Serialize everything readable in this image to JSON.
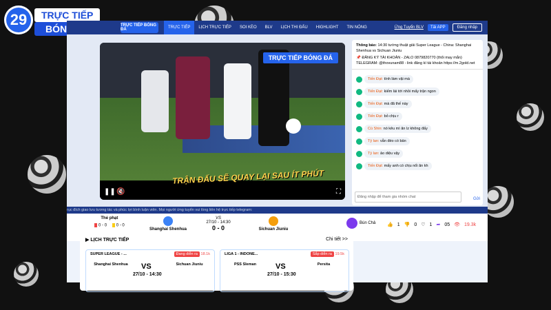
{
  "brand": {
    "number": "29",
    "line1": "TRỰC TIẾP",
    "line2": "BÓNG ĐÁ"
  },
  "nav": {
    "items": [
      "TRỰC TIẾP",
      "LỊCH TRỰC TIẾP",
      "SOI KÈO",
      "BLV",
      "LỊCH THI ĐẤU",
      "HIGHLIGHT",
      "TIN NÓNG"
    ],
    "apply_blv": "Ứng Tuyển BLV",
    "app": "Tải APP",
    "login": "Đăng nhập",
    "logo_text": "TRỰC TIẾP BÓNG ĐÁ"
  },
  "player": {
    "overlay_logo": "TRỰC TIẾP BÓNG ĐÁ",
    "marquee": "TRẬN ĐẤU SẼ QUAY LẠI SAU ÍT PHÚT"
  },
  "chat": {
    "notice_label": "Thông báo:",
    "notice_text": " 14:30 tường thuật giải Super League - China: Shanghai Shenhua vs Sichuan Jiuniu",
    "register": "📌 ĐĂNG KÝ TÀI KHOẢN - ZALO 0879820770 (thổi may mắn) TELEGRAM: @thovunam88 - link đăng kí tài khoản https://m.2gold.net",
    "messages": [
      {
        "user": "Tiến Đạt:",
        "text": "tính làm vậi mà"
      },
      {
        "user": "Tiến Đạt:",
        "text": "kiếm lái tới nhồi mấy trận ngon"
      },
      {
        "user": "Tiến Đạt:",
        "text": "mà đã thế này"
      },
      {
        "user": "Tiến Đạt:",
        "text": "bỏ chịu r"
      },
      {
        "user": "Cù Shin:",
        "text": "nó kêu mì ăn lz không đấy"
      },
      {
        "user": "Tý lan:",
        "text": "vẫn đéo có bản"
      },
      {
        "user": "Tý lan:",
        "text": "ảo diệu vậy"
      },
      {
        "user": "Tiến Đạt:",
        "text": "mấy anh có chịu nổi ăn kh"
      }
    ],
    "input_placeholder": "Đăng nhập để tham gia nhóm chat",
    "send": "Gửi"
  },
  "ticker": "rục đích giao lưu tương tác và phúc lợi bình luận viên. Mọi người ứng tuyển vui lòng liên hệ trực tiếp telegram:",
  "match": {
    "penalty_label": "Thẻ phạt",
    "home_red": "0",
    "home_yellow": "0",
    "away_red": "0",
    "away_yellow": "0",
    "home": "Shanghai Shenhua",
    "away": "Sichuan Jiuniu",
    "vs": "VS",
    "datetime": "27/10 - 14:30",
    "score": "0 - 0",
    "commentator": "Bún Chả",
    "likes": "1",
    "dislikes": "0",
    "hearts": "1",
    "shares": "05",
    "views": "19.3k"
  },
  "schedule": {
    "title": "LỊCH TRỰC TIẾP",
    "details": "Chi tiết >>",
    "cards": [
      {
        "league": "SUPER LEAGUE - ...",
        "badge": "Đang diễn ra",
        "views": "18.1k",
        "home": "Shanghai Shenhua",
        "away": "Sichuan Jiuniu",
        "time": "27/10 - 14:30",
        "vs": "VS"
      },
      {
        "league": "LIGA 1 - INDONE...",
        "badge": "Sắp diễn ra",
        "views": "19.5k",
        "home": "PSS Sleman",
        "away": "Persita",
        "time": "27/10 - 15:30",
        "vs": "VS"
      }
    ]
  },
  "colors": {
    "primary": "#1e3a8a",
    "accent": "#2563eb",
    "live": "#ef4444"
  }
}
